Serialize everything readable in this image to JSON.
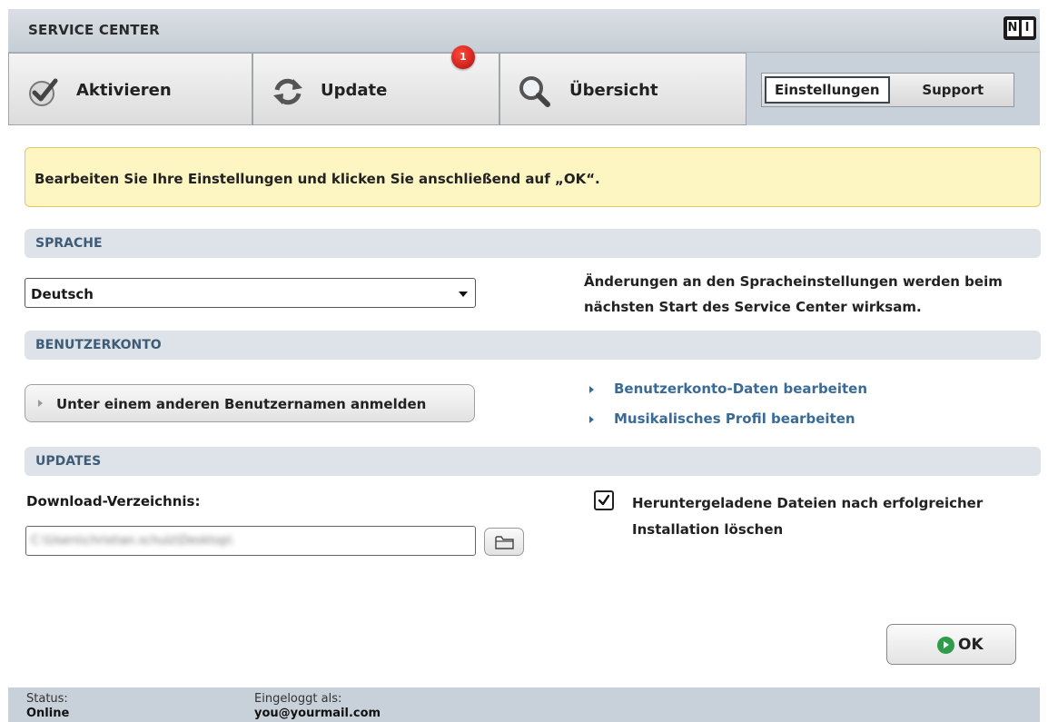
{
  "app": {
    "title": "SERVICE CENTER"
  },
  "tabs": [
    {
      "label": "Aktivieren"
    },
    {
      "label": "Update"
    },
    {
      "label": "Übersicht"
    }
  ],
  "update_badge": "1",
  "segment": {
    "settings": "Einstellungen",
    "support": "Support",
    "active": "Einstellungen"
  },
  "message": "Bearbeiten Sie Ihre Einstellungen und klicken Sie anschließend auf „OK“.",
  "sections": {
    "language": {
      "title": "SPRACHE",
      "selected": "Deutsch",
      "note_line1": "Änderungen an den Spracheinstellungen werden beim",
      "note_line2": "nächsten Start des Service Center wirksam."
    },
    "account": {
      "title": "BENUTZERKONTO",
      "login_button": "Unter einem anderen Benutzernamen anmelden",
      "link1": "Benutzerkonto-Daten bearbeiten",
      "link2": "Musikalisches Profil bearbeiten"
    },
    "updates": {
      "title": "UPDATES",
      "download_label": "Download-Verzeichnis:",
      "download_path": "C:\\Users\\christian.schulz\\Desktop\\",
      "delete_checkbox_line1": "Heruntergeladene Dateien nach erfolgreicher",
      "delete_checkbox_line2": "Installation löschen",
      "delete_checked": true
    }
  },
  "ok_button": "OK",
  "status": {
    "status_caption": "Status:",
    "status_value": "Online",
    "login_caption": "Eingeloggt als:",
    "login_value": "you@yourmail.com"
  },
  "colors": {
    "accent_link": "#3a6b96",
    "section_title": "#3e5c78",
    "message_bg": "#fdf6c3",
    "ok_green": "#2f9c4b",
    "badge_red": "#d11a1a"
  }
}
